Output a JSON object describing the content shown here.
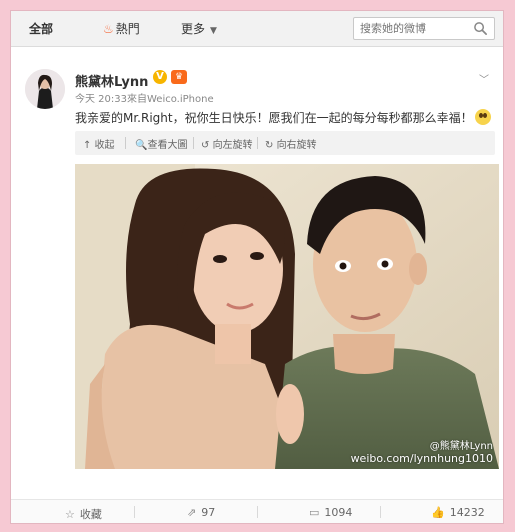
{
  "tabs": {
    "all": "全部",
    "hot": "熱門",
    "more": "更多"
  },
  "search": {
    "placeholder": "搜索她的微博"
  },
  "post": {
    "username": "熊黛林Lynn",
    "verified_badge": "V",
    "timestamp": "今天 20:33",
    "source": "來自Weico.iPhone",
    "text": "我亲爱的Mr.Right，祝你生日快乐！愿我们在一起的每分每秒都那么幸福！",
    "media_bar": {
      "collapse": "收起",
      "view_large": "查看大圖",
      "rotate_left": "向左旋转",
      "rotate_right": "向右旋转"
    },
    "watermark": {
      "line1": "@熊黛林Lynn",
      "line2": "weibo.com/lynnhung1010"
    }
  },
  "actions": {
    "favorite": "收藏",
    "repost_count": "97",
    "comment_count": "1094",
    "like_count": "14232"
  },
  "colors": {
    "background": "#f6c9d3",
    "accent_orange": "#f56a3c",
    "verified": "#f7b500"
  }
}
